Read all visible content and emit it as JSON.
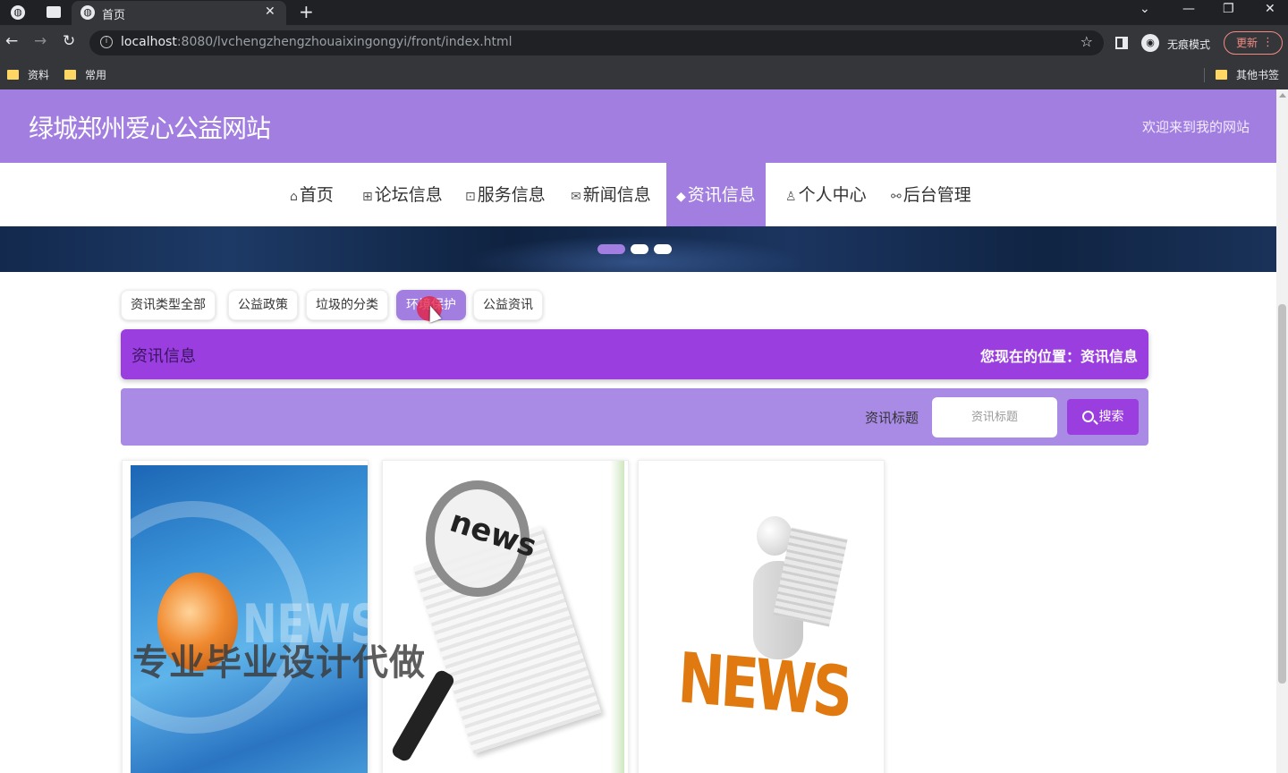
{
  "browser": {
    "tab_title": "首页",
    "tab_close": "✕",
    "new_tab": "+",
    "url_host": "localhost",
    "url_rest": ":8080/lvchengzhengzhouaixingongyi/front/index.html",
    "incognito_label": "无痕模式",
    "update_label": "更新",
    "bookmarks": [
      {
        "label": "资料"
      },
      {
        "label": "常用"
      }
    ],
    "other_bookmarks": "其他书签"
  },
  "site": {
    "title": "绿城郑州爱心公益网站",
    "welcome": "欢迎来到我的网站"
  },
  "menu": [
    {
      "label": "首页",
      "icon": "home-icon",
      "glyph": "⌂"
    },
    {
      "label": "论坛信息",
      "icon": "forum-icon",
      "glyph": "⊞"
    },
    {
      "label": "服务信息",
      "icon": "service-icon",
      "glyph": "⊡"
    },
    {
      "label": "新闻信息",
      "icon": "mail-icon",
      "glyph": "✉"
    },
    {
      "label": "资讯信息",
      "icon": "layers-icon",
      "glyph": "◆",
      "active": true
    },
    {
      "label": "个人中心",
      "icon": "user-icon",
      "glyph": "♙"
    },
    {
      "label": "后台管理",
      "icon": "link-icon",
      "glyph": "⚯"
    }
  ],
  "filters": [
    {
      "label": "资讯类型全部"
    },
    {
      "label": "公益政策"
    },
    {
      "label": "垃圾的分类"
    },
    {
      "label": "环境保护",
      "active": true
    },
    {
      "label": "公益资讯"
    }
  ],
  "info_bar": {
    "title": "资讯信息",
    "location": "您现在的位置：资讯信息"
  },
  "search": {
    "label": "资讯标题",
    "placeholder": "资讯标题",
    "button": "搜索"
  },
  "cards": [
    {
      "image": "news-globe-image",
      "image_text": "NEWS"
    },
    {
      "image": "news-magnifier-image",
      "image_text": "news"
    },
    {
      "image": "news-reader-image",
      "image_text": "NEWS"
    }
  ],
  "watermark": "专业毕业设计代做",
  "colors": {
    "accent": "#a17ee0",
    "accent_dark": "#9b3ee0"
  }
}
